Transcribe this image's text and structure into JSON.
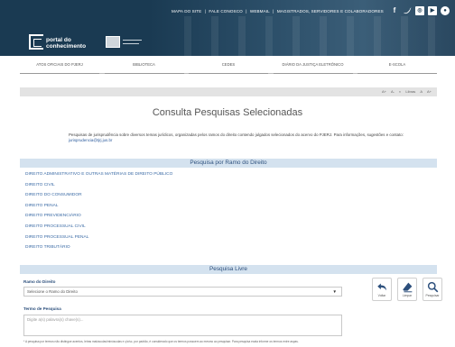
{
  "header": {
    "top_links": [
      "MAPA DO SITE",
      "FALE CONOSCO",
      "WEBMAIL",
      "MAGISTRADOS, SERVIDORES E COLABORADORES"
    ],
    "separator": "|",
    "social_icons": [
      "facebook-icon",
      "twitter-icon",
      "instagram-icon",
      "youtube-icon",
      "flickr-icon"
    ],
    "logo_line1": "portal do",
    "logo_line2": "conhecimento"
  },
  "nav": {
    "items": [
      "ATOS OFICIAIS DO PJERJ",
      "BIBLIOTECA",
      "CEDES",
      "DIÁRIO DA JUSTIÇA ELETRÔNICO",
      "E-SCOLA"
    ]
  },
  "accessibility": {
    "tools": [
      "A+",
      "A-",
      "◐",
      "Libras",
      "A",
      "A+"
    ]
  },
  "page": {
    "title": "Consulta Pesquisas Selecionadas",
    "intro_text": "Pesquisas de jurisprudência sobre diversos temas jurídicos, organizadas pelos ramos do direito contendo julgados selecionados do acervo do PJERJ. Para informações, sugestões e contato:",
    "contact_email": "jurisprudencia@tjrj.jus.br"
  },
  "branch_section": {
    "title": "Pesquisa por Ramo do Direito",
    "items": [
      "DIREITO ADMINISTRATIVO E OUTRAS MATÉRIAS DE DIREITO PÚBLICO",
      "DIREITO CIVIL",
      "DIREITO DO CONSUMIDOR",
      "DIREITO PENAL",
      "DIREITO PREVIDENCIÁRIO",
      "DIREITO PROCESSUAL CIVIL",
      "DIREITO PROCESSUAL PENAL",
      "DIREITO TRIBUTÁRIO"
    ]
  },
  "free_search": {
    "title": "Pesquisa Livre",
    "branch_label": "Ramo do Direito",
    "branch_select_value": "Selecione o Ramo do Direito",
    "term_label": "Termo de Pesquisa",
    "term_placeholder": "Digite a(s) palavra(s) chave(s)...",
    "buttons": {
      "back": "Voltar",
      "clear": "Limpar",
      "search": "Pesquisar"
    },
    "footnote": "* A pesquisa por termos não distingue acentos, letras maiúsculas/minúsculas e ç/c/sc, por padrão, é considerado que os termos possuem ao mesmo ao pesquisar. Para pesquisa exata informe os termos entre aspas."
  },
  "colors": {
    "header_bg": "#1a3a52",
    "section_head_bg": "#d4e2ef",
    "link": "#3a6aa5"
  }
}
